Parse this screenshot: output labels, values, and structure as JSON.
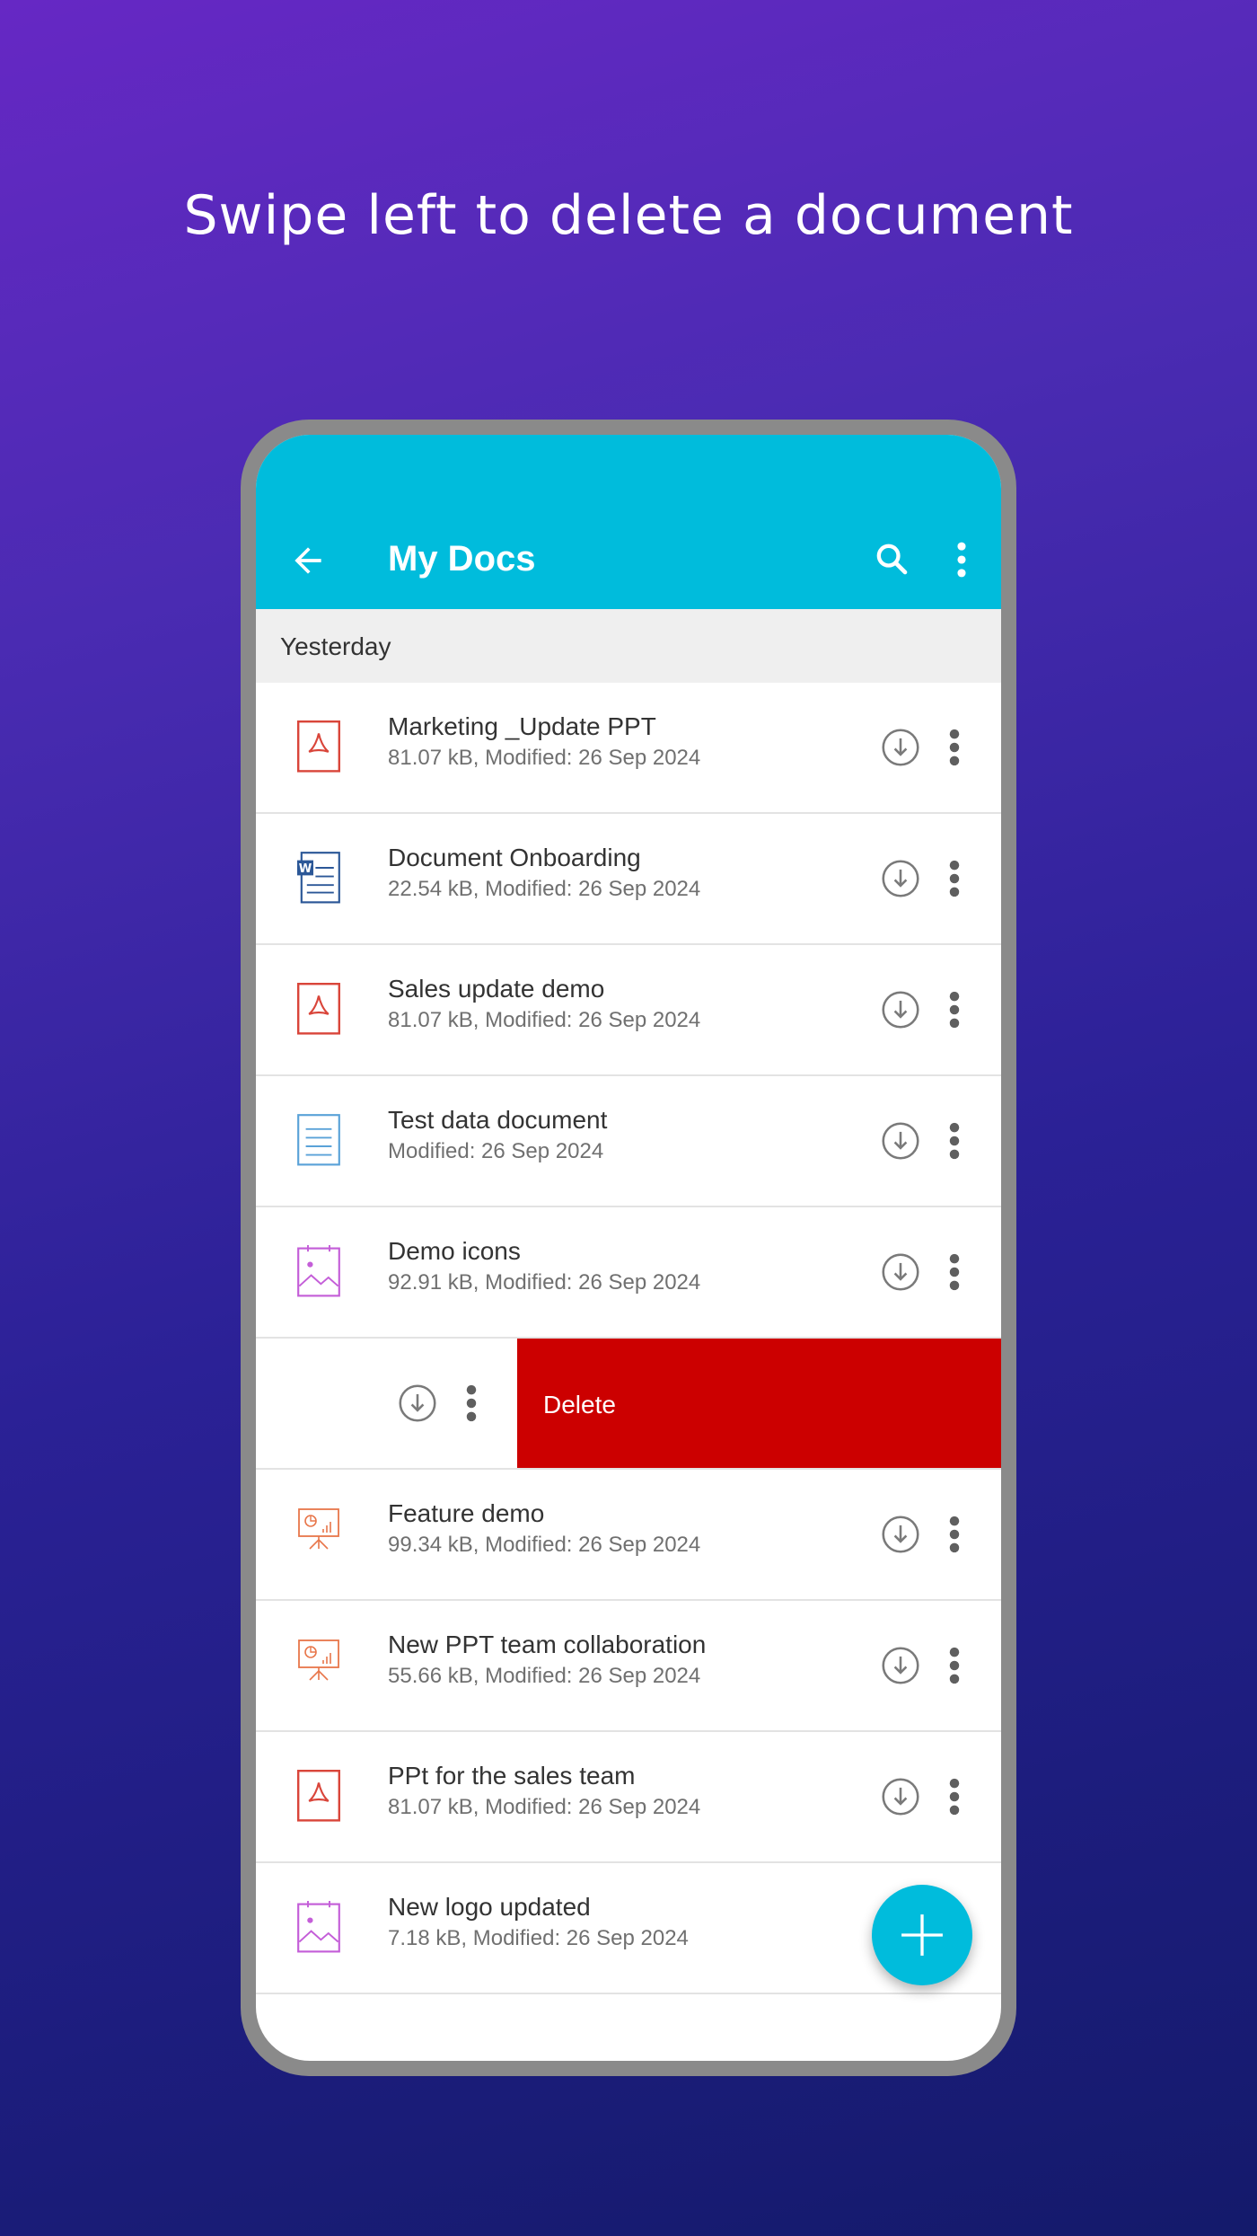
{
  "headline": "Swipe left to delete a document",
  "app": {
    "title": "My Docs",
    "icons": [
      "back-arrow-icon",
      "search-icon",
      "more-vert-icon"
    ],
    "accent_color": "#00bcdc"
  },
  "section_header": "Yesterday",
  "documents": [
    {
      "name": "Marketing _Update PPT",
      "meta": "81.07 kB, Modified: 26 Sep 2024",
      "type": "pdf"
    },
    {
      "name": "Document Onboarding",
      "meta": "22.54 kB, Modified: 26 Sep 2024",
      "type": "word"
    },
    {
      "name": "Sales update demo",
      "meta": "81.07 kB, Modified: 26 Sep 2024",
      "type": "pdf"
    },
    {
      "name": "Test data document",
      "meta": "Modified: 26 Sep 2024",
      "type": "text"
    },
    {
      "name": "Demo icons",
      "meta": "92.91 kB, Modified: 26 Sep 2024",
      "type": "image"
    },
    {
      "swiped": true,
      "delete_label": "Delete"
    },
    {
      "name": "Feature demo",
      "meta": "99.34 kB, Modified: 26 Sep 2024",
      "type": "presentation"
    },
    {
      "name": "New PPT  team collaboration",
      "meta": "55.66 kB, Modified: 26 Sep 2024",
      "type": "presentation"
    },
    {
      "name": "PPt for the sales team",
      "meta": "81.07 kB, Modified: 26 Sep 2024",
      "type": "pdf"
    },
    {
      "name": "New logo updated",
      "meta": "7.18 kB, Modified: 26 Sep 2024",
      "type": "image"
    }
  ],
  "colors": {
    "delete_red": "#cc0000",
    "pdf_red": "#d9453a",
    "word_blue": "#2b5797",
    "text_blue": "#5aa2d8",
    "image_purple": "#c45ed8",
    "presentation_orange": "#e8764a"
  },
  "fab": {
    "icon": "plus-icon"
  }
}
